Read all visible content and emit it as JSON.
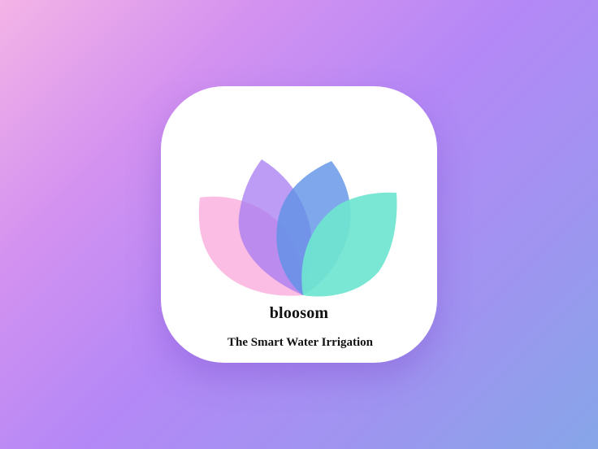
{
  "app": {
    "name": "bloosom",
    "tagline": "The Smart Water Irrigation"
  },
  "logo": {
    "icon": "lotus-flower-icon",
    "colors": {
      "pink_petal": "#fbb6e0",
      "purple_petal": "#a57bf0",
      "blue_petal": "#6f9ee8",
      "teal_petal": "#6ee5cf"
    }
  },
  "colors": {
    "background_start": "#f4b4e6",
    "background_end": "#86a6e8",
    "card": "#ffffff",
    "text": "#111111"
  }
}
